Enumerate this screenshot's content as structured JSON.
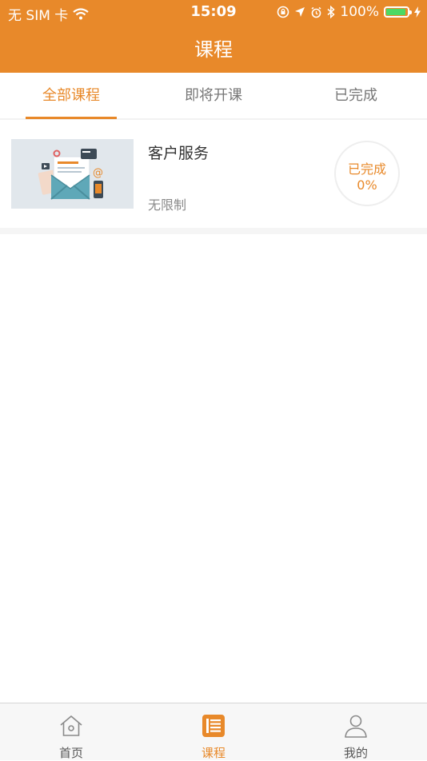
{
  "status_bar": {
    "carrier": "无 SIM 卡",
    "time": "15:09",
    "battery": "100%"
  },
  "header": {
    "title": "课程"
  },
  "tabs": [
    {
      "label": "全部课程",
      "active": true
    },
    {
      "label": "即将开课",
      "active": false
    },
    {
      "label": "已完成",
      "active": false
    }
  ],
  "courses": [
    {
      "title": "客户服务",
      "limit": "无限制",
      "status_label": "已完成",
      "progress": "0%"
    }
  ],
  "bottom_nav": [
    {
      "label": "首页",
      "icon": "home-icon",
      "active": false
    },
    {
      "label": "课程",
      "icon": "course-icon",
      "active": true
    },
    {
      "label": "我的",
      "icon": "profile-icon",
      "active": false
    }
  ],
  "colors": {
    "accent": "#e8892a",
    "battery": "#4cd964"
  }
}
